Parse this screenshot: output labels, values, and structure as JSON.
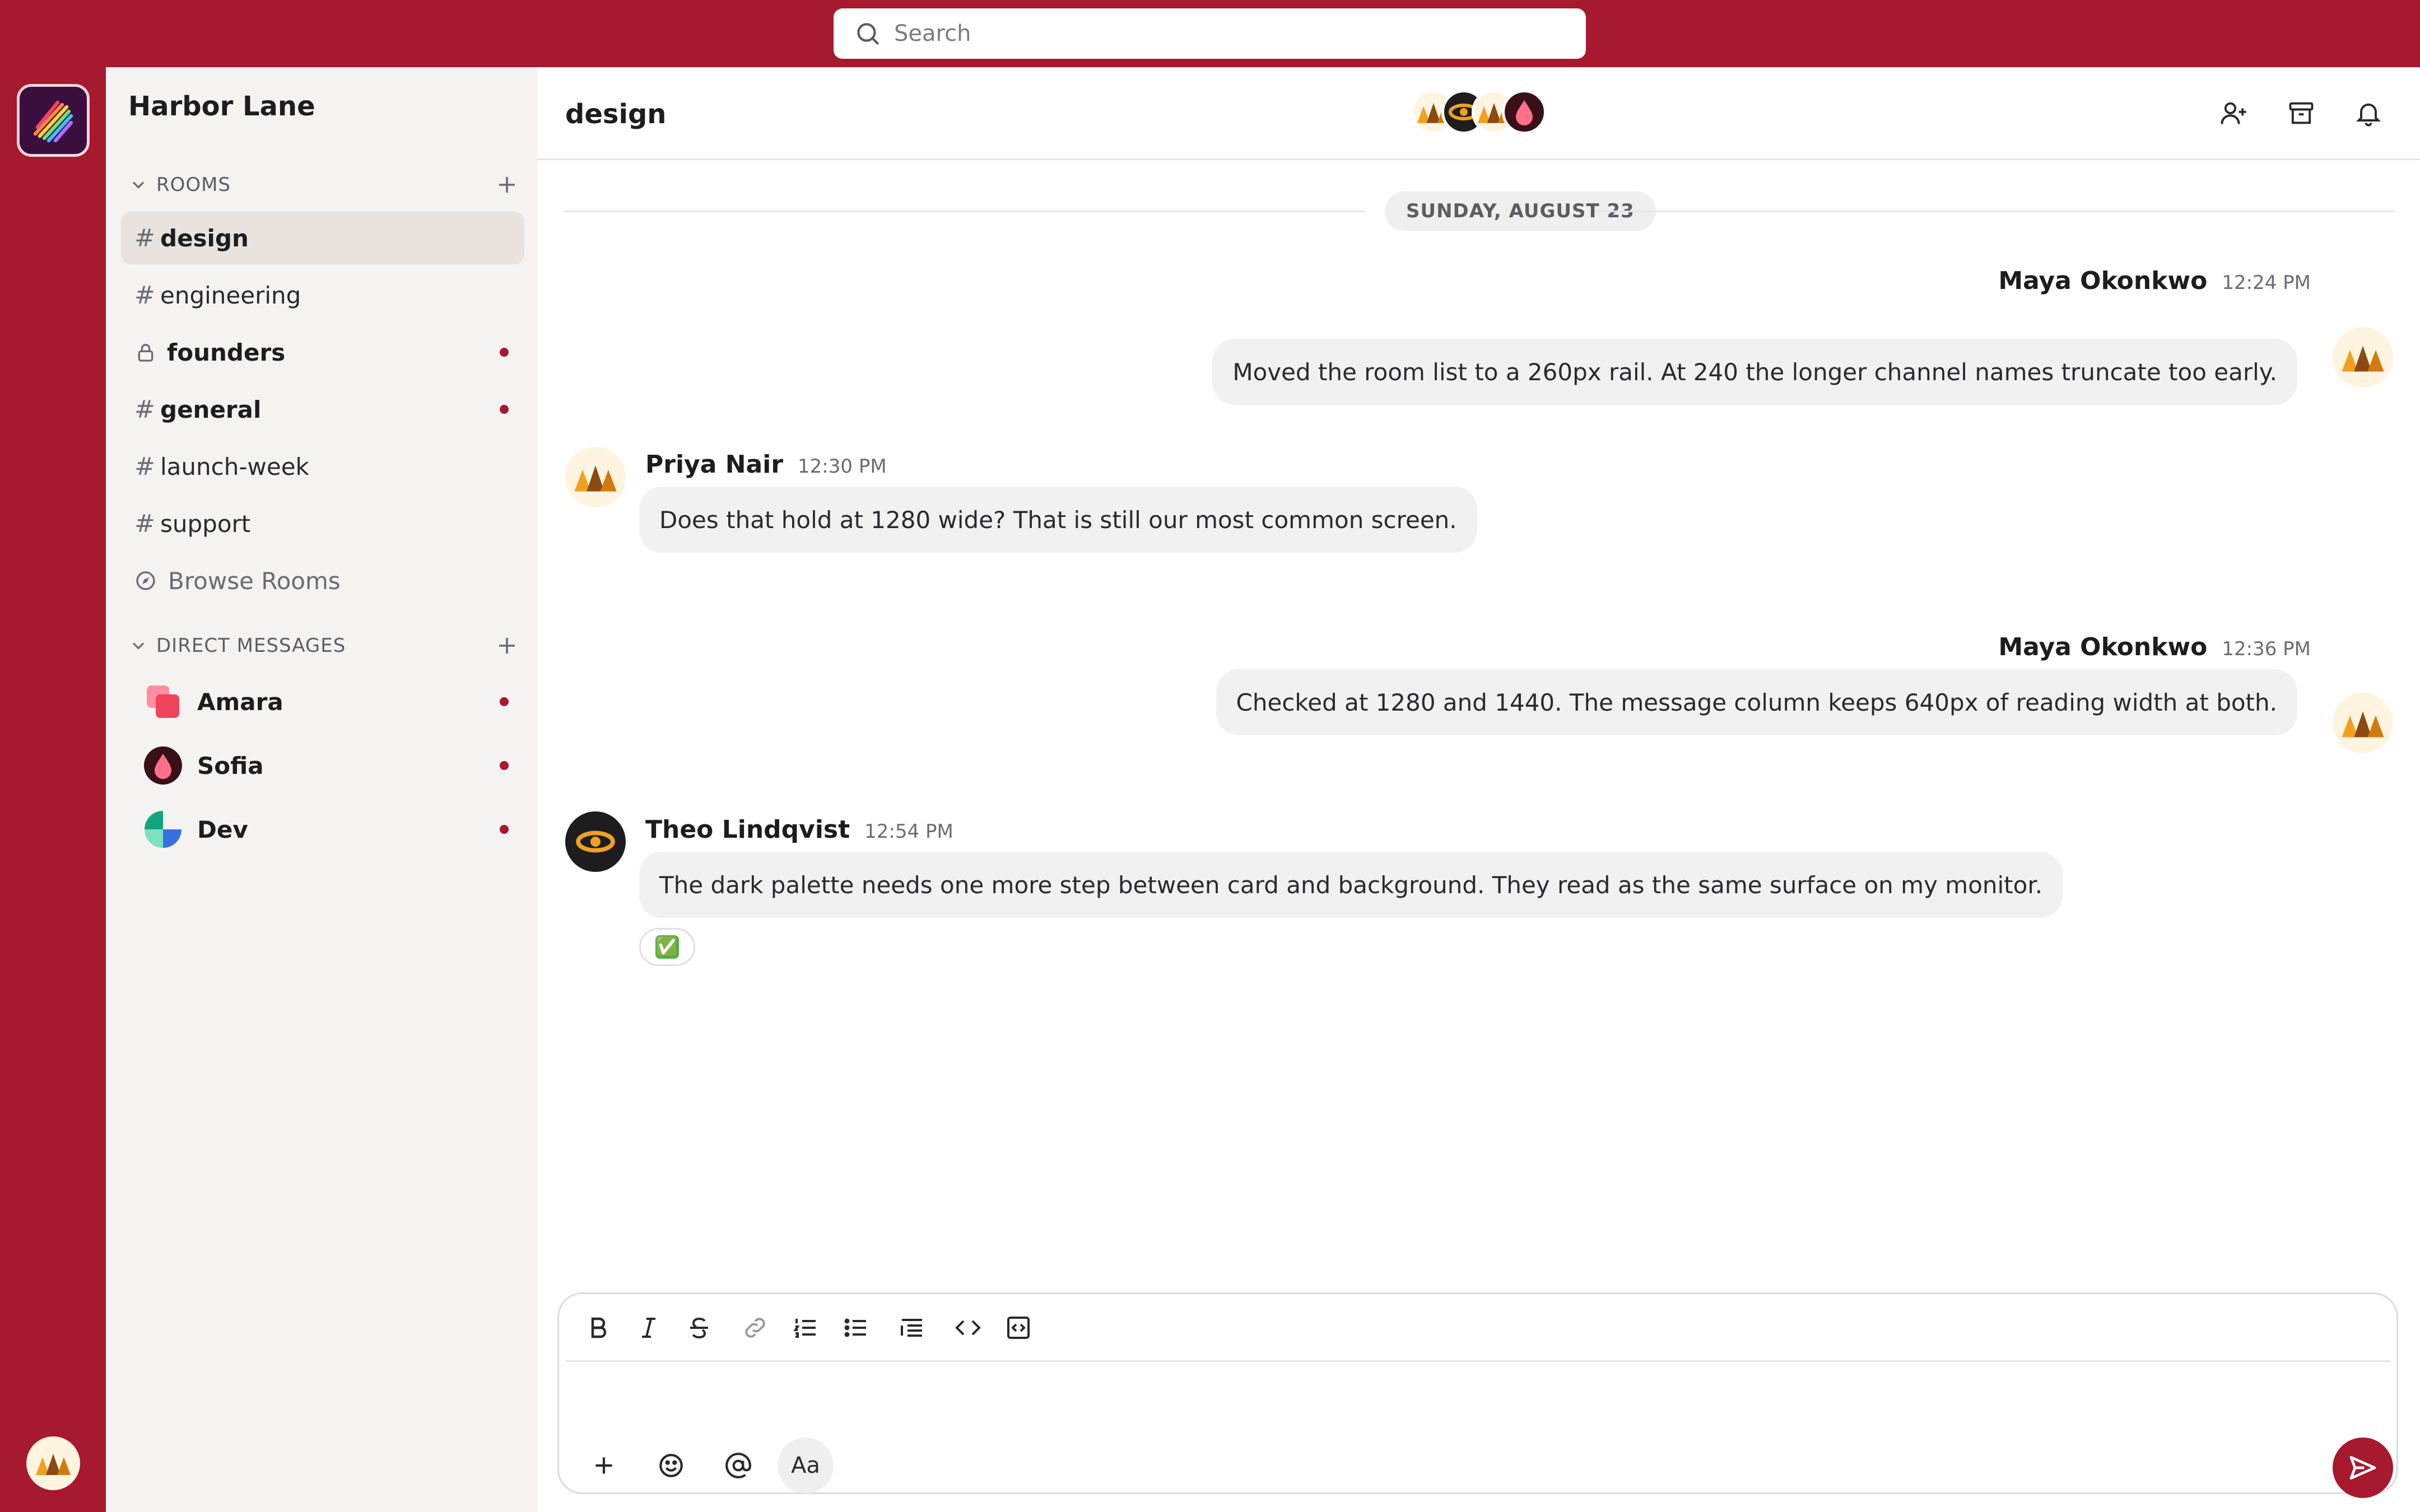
{
  "search": {
    "placeholder": "Search"
  },
  "workspace": {
    "name": "Harbor Lane"
  },
  "sidebar": {
    "rooms_header": "ROOMS",
    "rooms": [
      {
        "label": "design",
        "icon": "hash",
        "active": true,
        "bold": true,
        "unread": false
      },
      {
        "label": "engineering",
        "icon": "hash",
        "active": false,
        "bold": false,
        "unread": false
      },
      {
        "label": "founders",
        "icon": "lock-icon",
        "active": false,
        "bold": true,
        "unread": true
      },
      {
        "label": "general",
        "icon": "hash",
        "active": false,
        "bold": true,
        "unread": true
      },
      {
        "label": "launch-week",
        "icon": "hash",
        "active": false,
        "bold": false,
        "unread": false
      },
      {
        "label": "support",
        "icon": "hash",
        "active": false,
        "bold": false,
        "unread": false
      }
    ],
    "hash_glyph": "#",
    "browse_label": "Browse Rooms",
    "dm_header": "DIRECT MESSAGES",
    "dms": [
      {
        "label": "Amara",
        "unread": true
      },
      {
        "label": "Sofia",
        "unread": true
      },
      {
        "label": "Dev",
        "unread": true
      }
    ]
  },
  "room": {
    "title": "design"
  },
  "date_divider": "SUNDAY, AUGUST 23",
  "messages": [
    {
      "author": "Maya Okonkwo",
      "time": "12:24 PM",
      "text": "Moved the room list to a 260px rail. At 240 the longer channel names truncate too early.",
      "own": true
    },
    {
      "author": "Priya Nair",
      "time": "12:30 PM",
      "text": "Does that hold at 1280 wide? That is still our most common screen.",
      "own": false
    },
    {
      "author": "Maya Okonkwo",
      "time": "12:36 PM",
      "text": "Checked at 1280 and 1440. The message column keeps 640px of reading width at both.",
      "own": true
    },
    {
      "author": "Theo Lindqvist",
      "time": "12:54 PM",
      "text": "The dark palette needs one more step between card and background. They read as the same surface on my monitor.",
      "own": false
    }
  ],
  "reaction": {
    "emoji": "✅"
  },
  "composer": {
    "format_label": "Aa",
    "toolbar_icons": [
      "bold-icon",
      "italic-icon",
      "strikethrough-icon",
      "link-icon",
      "ordered-list-icon",
      "bullet-list-icon",
      "blockquote-icon",
      "code-icon",
      "code-block-icon"
    ]
  },
  "colors": {
    "brand": "#a6192e",
    "sidebar_bg": "#f4f3f2",
    "active_item": "#e8e3df",
    "bubble": "#f1f1f1",
    "unread_dot": "#a6192e"
  }
}
